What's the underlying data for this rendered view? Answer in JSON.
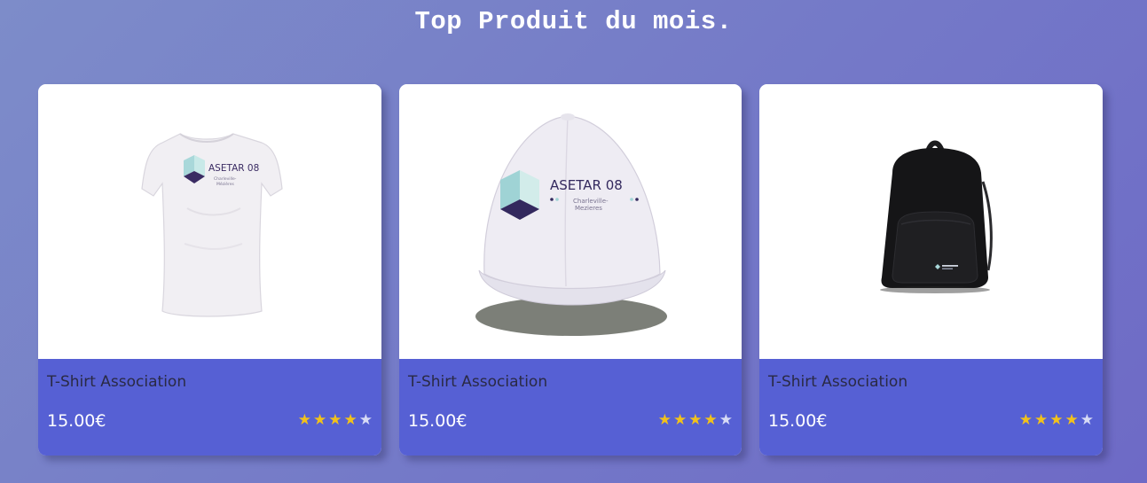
{
  "page": {
    "title": "Top Produit du mois."
  },
  "products": [
    {
      "name": "T-Shirt Association",
      "price": "15.00€",
      "image": "white-tshirt-with-asetar-logo",
      "logo_title": "ASETAR 08",
      "logo_subtitle": "Charleville-Mézières",
      "rating": 4,
      "rating_max": 5
    },
    {
      "name": "T-Shirt Association",
      "price": "15.00€",
      "image": "white-cap-with-asetar-logo",
      "logo_title": "ASETAR 08",
      "logo_subtitle_line1": "Charleville-",
      "logo_subtitle_line2": "Mezieres",
      "rating": 4,
      "rating_max": 5
    },
    {
      "name": "T-Shirt Association",
      "price": "15.00€",
      "image": "black-backpack-with-logo",
      "rating": 4,
      "rating_max": 5
    }
  ],
  "colors": {
    "card_footer": "#5660d4",
    "star_filled": "#f2c21b",
    "star_empty": "#d7dbf5",
    "title_text": "#ffffff"
  }
}
